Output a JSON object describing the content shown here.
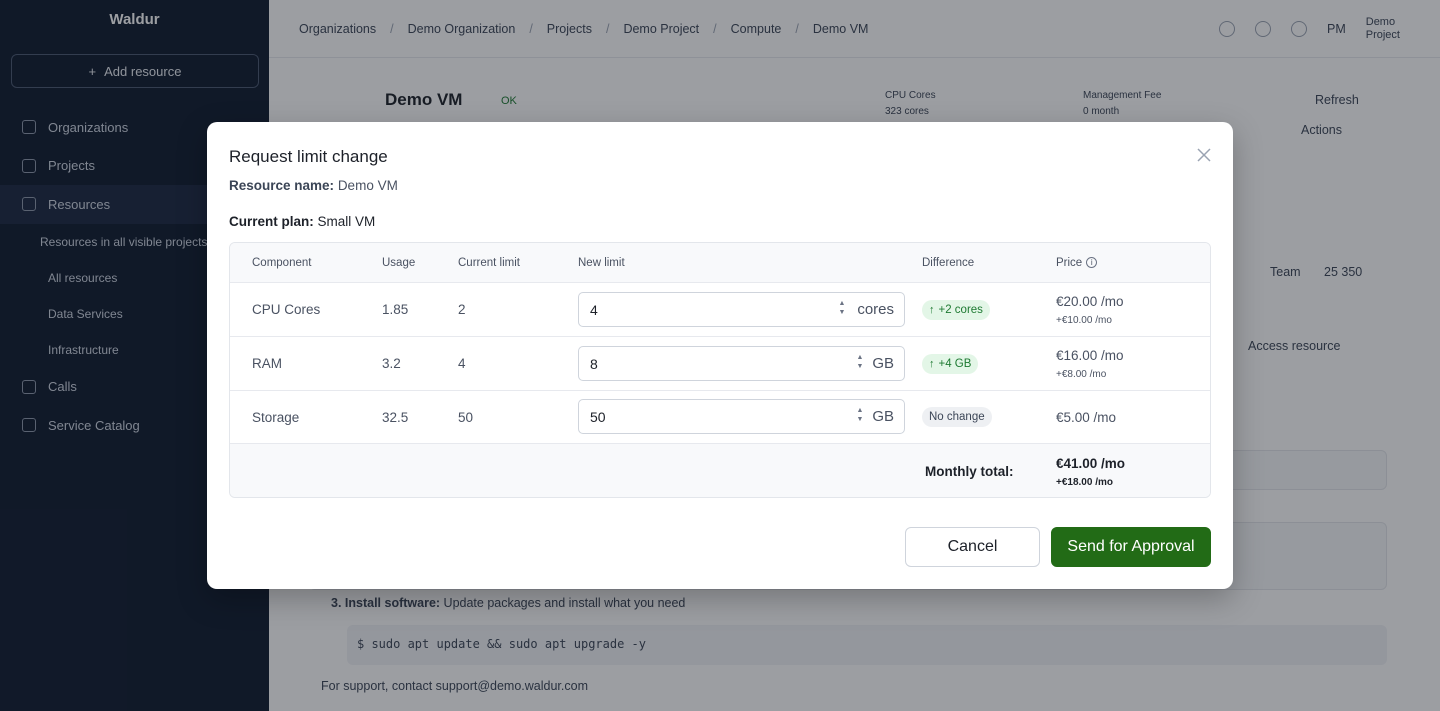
{
  "background": {
    "brand": "Waldur",
    "add_resource": "Add resource",
    "nav": [
      "Organizations",
      "Projects",
      "Resources",
      "Resources in all visible projects",
      "All resources",
      "Data Services",
      "Infrastructure",
      "Calls",
      "Service Catalog"
    ],
    "breadcrumbs": [
      "Organizations",
      "Demo Organization",
      "Projects",
      "Demo Project",
      "Compute",
      "Demo VM"
    ],
    "user_initials": "PM",
    "user_label_1": "Demo",
    "user_label_2": "Project",
    "resource_title": "Demo VM",
    "status": "OK",
    "cpu_label": "CPU Cores",
    "cpu_value": "323 cores",
    "mgmt_label": "Management Fee",
    "mgmt_value": "0 month",
    "refresh": "Refresh",
    "actions": "Actions",
    "team_label": "Team",
    "team_value": "25 350",
    "access_resource": "Access resource",
    "install_label": "3. Install software:",
    "install_text": "Update packages and install what you need",
    "code": "$  sudo apt update && sudo apt upgrade -y",
    "support": "For support, contact support@demo.waldur.com"
  },
  "modal": {
    "title": "Request limit change",
    "resource_name_label": "Resource name",
    "resource_name": "Demo VM",
    "current_plan_label": "Current plan",
    "current_plan": "Small VM",
    "columns": [
      "Component",
      "Usage",
      "Current limit",
      "New limit",
      "Difference",
      "Price"
    ],
    "rows": [
      {
        "component": "CPU Cores",
        "usage": "1.85",
        "current": "2",
        "new_value": "4",
        "unit": "cores",
        "diff": "+2 cores",
        "diff_type": "up",
        "price": "€20.00 /mo",
        "price_delta": "+€10.00 /mo"
      },
      {
        "component": "RAM",
        "usage": "3.2",
        "current": "4",
        "new_value": "8",
        "unit": "GB",
        "diff": "+4 GB",
        "diff_type": "up",
        "price": "€16.00 /mo",
        "price_delta": "+€8.00 /mo"
      },
      {
        "component": "Storage",
        "usage": "32.5",
        "current": "50",
        "new_value": "50",
        "unit": "GB",
        "diff": "No change",
        "diff_type": "none",
        "price": "€5.00 /mo",
        "price_delta": ""
      }
    ],
    "total_label": "Monthly total:",
    "total_price": "€41.00 /mo",
    "total_delta": "+€18.00 /mo",
    "cancel": "Cancel",
    "submit": "Send for Approval",
    "colors": {
      "primary": "#226b16",
      "badge_up_bg": "#e3f6e7",
      "badge_up_text": "#1e7a32"
    }
  }
}
